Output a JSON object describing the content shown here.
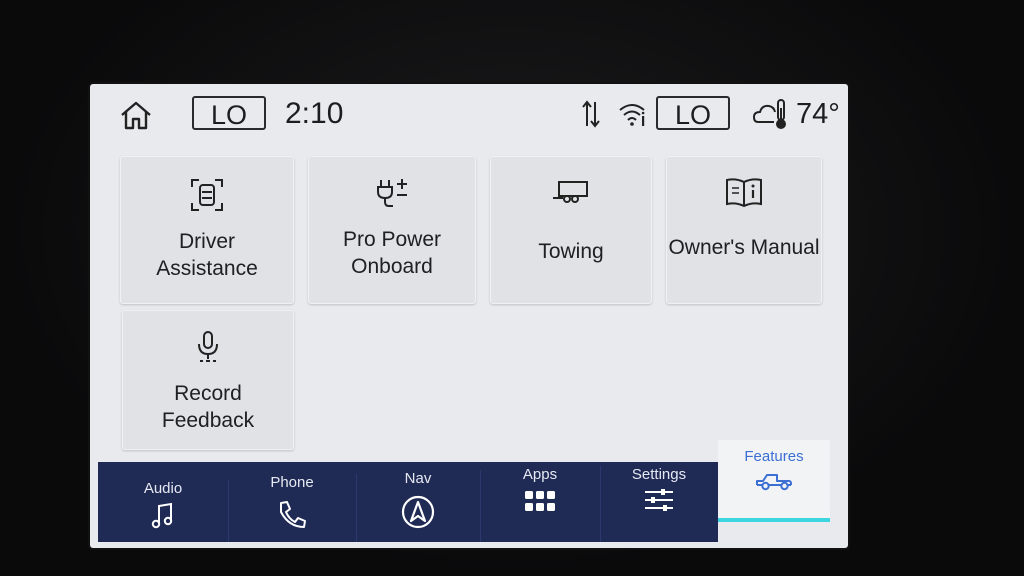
{
  "status_bar": {
    "lo_left": "LO",
    "time": "2:10",
    "lo_right": "LO",
    "temperature": "74°"
  },
  "tiles": [
    {
      "label_line1": "Driver",
      "label_line2": "Assistance",
      "icon": "driver-assist-icon"
    },
    {
      "label_line1": "Pro Power",
      "label_line2": "Onboard",
      "icon": "plug-icon"
    },
    {
      "label_line1": "Towing",
      "icon": "trailer-icon"
    },
    {
      "label_line1": "Owner's Manual",
      "icon": "book-info-icon"
    },
    {
      "label_line1": "Record",
      "label_line2": "Feedback",
      "icon": "microphone-icon"
    }
  ],
  "nav": {
    "audio": "Audio",
    "phone": "Phone",
    "nav": "Nav",
    "apps": "Apps",
    "settings": "Settings",
    "features": "Features"
  },
  "colors": {
    "navbar": "#1f2a55",
    "features_accent": "#3b6fd4",
    "active_indicator": "#3dd6e0"
  }
}
